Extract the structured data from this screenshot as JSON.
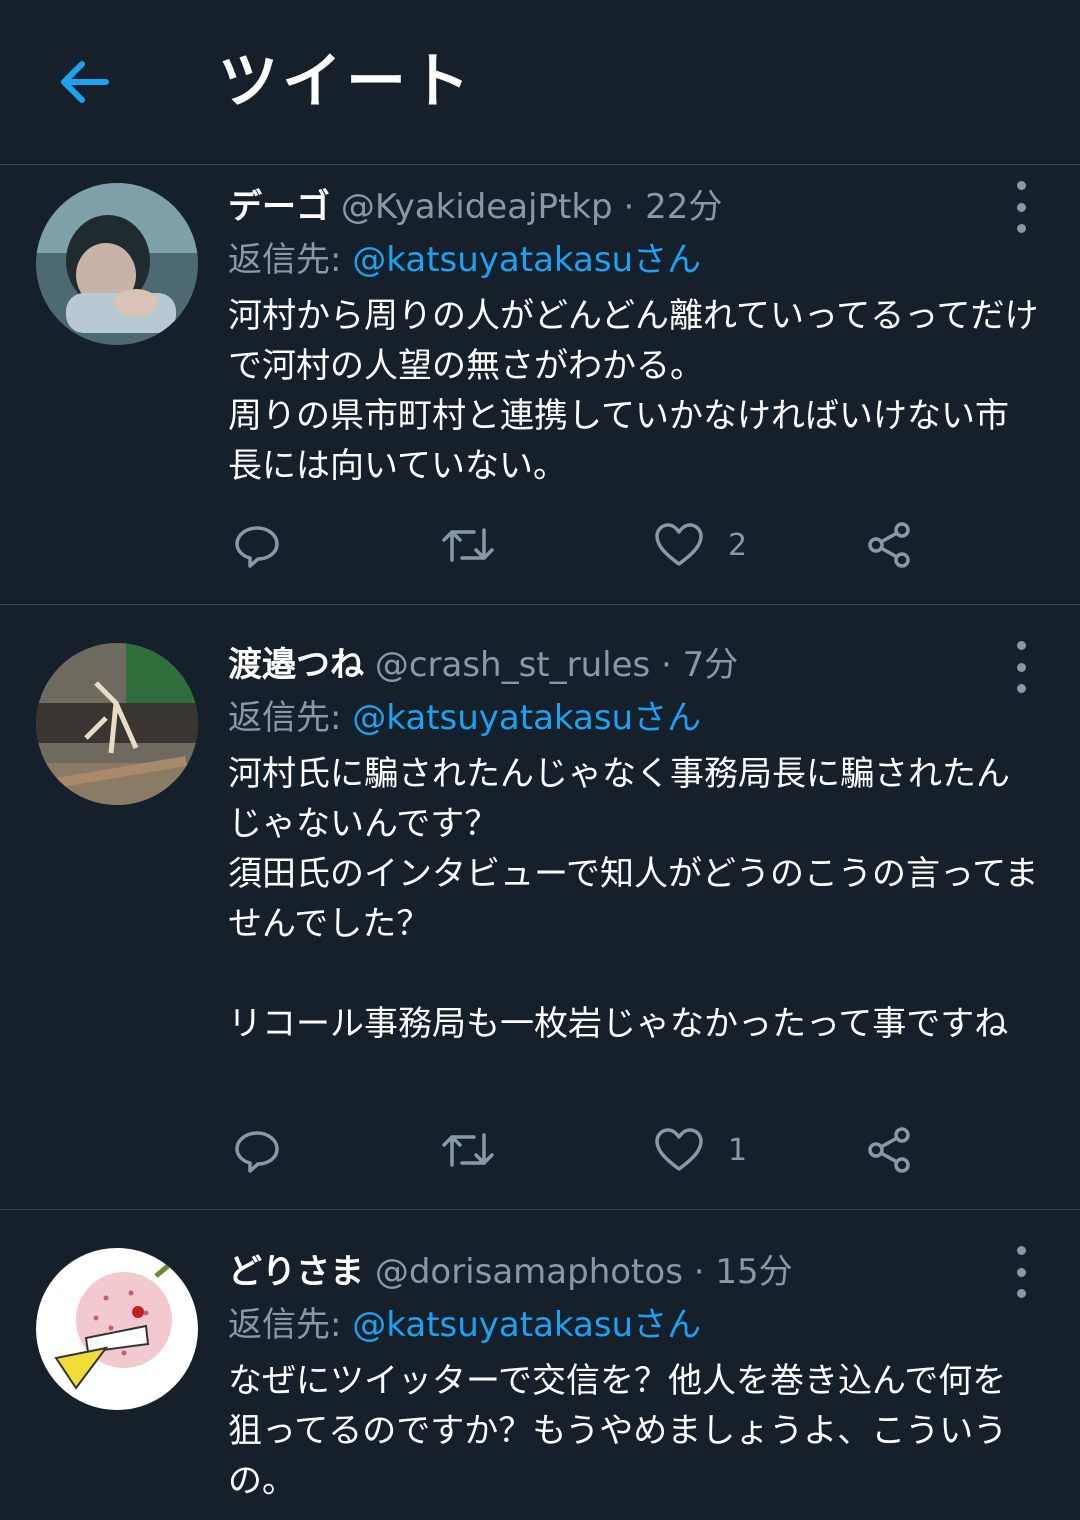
{
  "header": {
    "title": "ツイート",
    "back_icon": "arrow-left-icon"
  },
  "colors": {
    "background": "#15202b",
    "accent": "#1da1f2",
    "muted": "#8899a6",
    "divider": "#38444d"
  },
  "tweets": [
    {
      "name": "デーゴ",
      "handle": "@KyakideajPtkp",
      "dot": "·",
      "time": "22分",
      "reply_prefix": "返信先: ",
      "reply_mention": "@katsuyatakasuさん",
      "text": "河村から周りの人がどんどん離れていってるってだけで河村の人望の無さがわかる。\n周りの県市町村と連携していかなければいけない市長には向いていない。",
      "like_count": "2"
    },
    {
      "name": "渡邉つね",
      "handle": "@crash_st_rules",
      "dot": "·",
      "time": "7分",
      "reply_prefix": "返信先: ",
      "reply_mention": "@katsuyatakasuさん",
      "text": "河村氏に騙されたんじゃなく事務局長に騙されたんじゃないんです？\n須田氏のインタビューで知人がどうのこうの言ってませんでした？\n\nリコール事務局も一枚岩じゃなかったって事ですね",
      "like_count": "1"
    },
    {
      "name": "どりさま",
      "handle": "@dorisamaphotos",
      "dot": "·",
      "time": "15分",
      "reply_prefix": "返信先: ",
      "reply_mention": "@katsuyatakasuさん",
      "text": "なぜにツイッターで交信を？他人を巻き込んで何を狙ってるのですか？もうやめましょうよ、こういうの。",
      "like_count": ""
    }
  ]
}
